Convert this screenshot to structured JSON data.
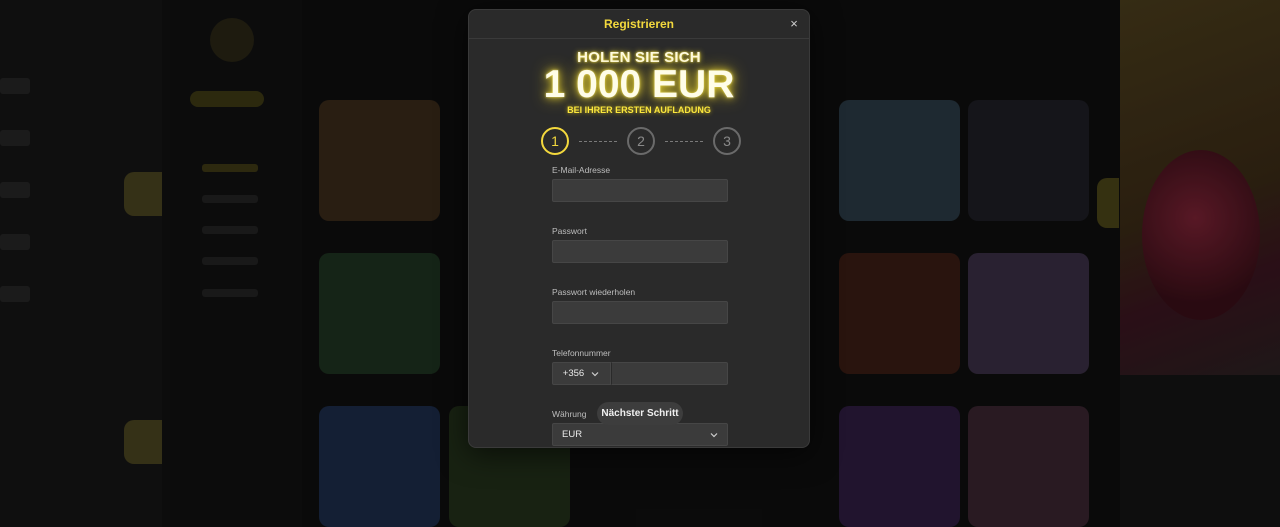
{
  "modal": {
    "title": "Registrieren",
    "close_symbol": "×"
  },
  "promo": {
    "line1": "HOLEN SIE SICH",
    "amount": "1 000 EUR",
    "line3": "BEI IHRER ERSTEN AUFLADUNG"
  },
  "steps": [
    {
      "number": "1",
      "active": true
    },
    {
      "number": "2",
      "active": false
    },
    {
      "number": "3",
      "active": false
    }
  ],
  "form": {
    "email_label": "E-Mail-Adresse",
    "email_value": "",
    "password_label": "Passwort",
    "password_value": "",
    "password_repeat_label": "Passwort wiederholen",
    "password_repeat_value": "",
    "phone_label": "Telefonnummer",
    "phone_country_code": "+356",
    "phone_value": "",
    "currency_label": "Währung",
    "currency_value": "EUR"
  },
  "next_button_label": "Nächster Schritt",
  "colors": {
    "accent": "#f3d83d",
    "modal_bg": "#2a2a2a",
    "field_bg": "#3b3b3b"
  },
  "icons": {
    "close": "close-icon",
    "dropdown": "chevron-down-icon"
  }
}
